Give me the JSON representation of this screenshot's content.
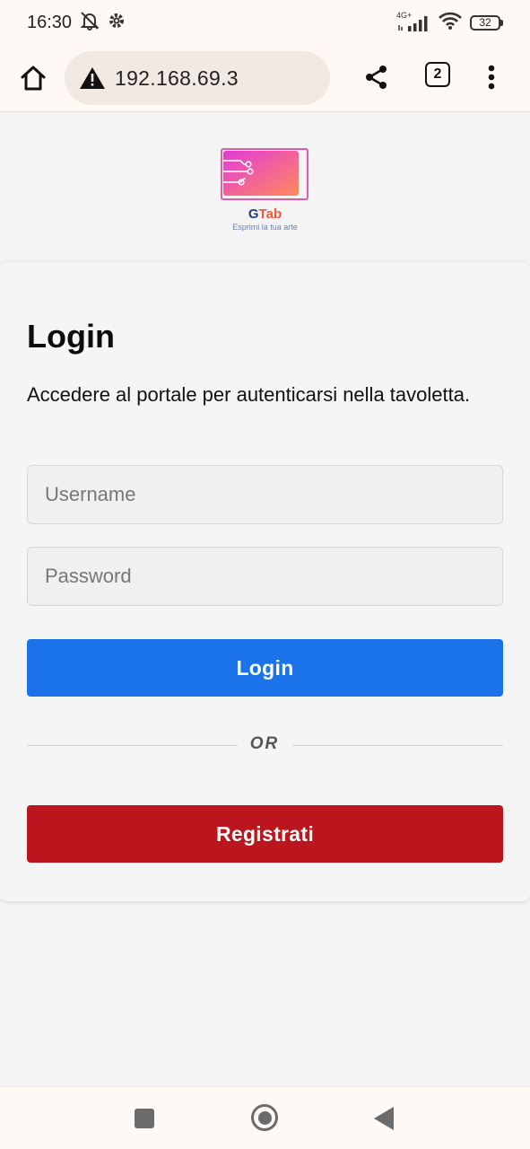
{
  "status_bar": {
    "time": "16:30",
    "network": "4G+",
    "battery": "32"
  },
  "browser": {
    "url": "192.168.69.3",
    "tab_count": "2"
  },
  "logo": {
    "name_part1": "G",
    "name_part2": "Tab",
    "tagline": "Esprimi la tua arte",
    "colors": {
      "gradient_start": "#e23ad9",
      "gradient_end": "#ff8a5c",
      "name_dark": "#2b3a8c",
      "name_accent": "#f0583b"
    }
  },
  "login": {
    "title": "Login",
    "description": "Accedere al portale per autenticarsi nella tavoletta.",
    "username_placeholder": "Username",
    "password_placeholder": "Password",
    "login_button": "Login",
    "divider_text": "OR",
    "register_button": "Registrati"
  },
  "colors": {
    "login_button": "#1a73e8",
    "register_button": "#bb151e"
  }
}
